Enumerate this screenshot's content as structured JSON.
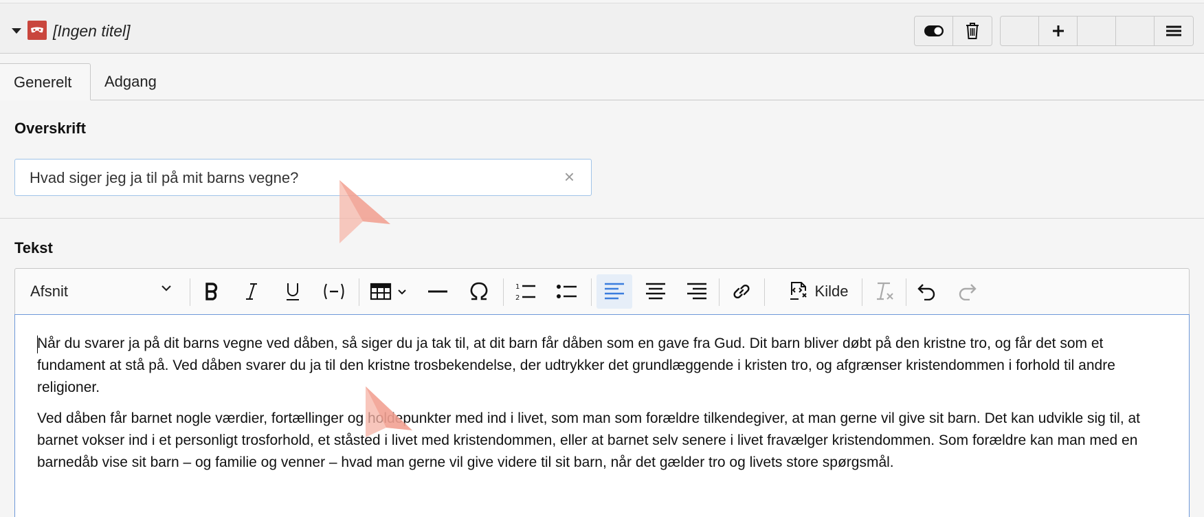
{
  "header": {
    "title": "[Ingen titel]",
    "buttons": {
      "toggle": "toggle-icon",
      "delete": "trash-icon",
      "add": "plus-icon",
      "menu": "hamburger-icon"
    }
  },
  "tabs": [
    {
      "label": "Generelt",
      "active": true
    },
    {
      "label": "Adgang",
      "active": false
    }
  ],
  "fields": {
    "overskrift": {
      "label": "Overskrift",
      "value": "Hvad siger jeg ja til på mit barns vegne?"
    },
    "tekst": {
      "label": "Tekst"
    }
  },
  "toolbar": {
    "format_select": "Afsnit",
    "source_label": "Kilde"
  },
  "content": {
    "paragraphs": [
      "Når du svarer ja på dit barns vegne ved dåben, så siger du ja tak til, at dit barn får dåben som en gave fra Gud. Dit barn bliver døbt på den kristne tro, og får det som et fundament at stå på. Ved dåben svarer du ja til den kristne trosbekendelse, der udtrykker det grundlæggende i kristen tro, og afgrænser kristendommen i forhold til andre religioner.",
      "Ved dåben får barnet nogle værdier, fortællinger og holdepunkter med ind i livet, som man som forældre tilkendegiver, at man gerne vil give sit barn. Det kan udvikle sig til, at barnet vokser ind i et personligt trosforhold, et ståsted i livet med kristendommen, eller at barnet selv senere i livet fravælger kristendommen. Som forældre kan man med en barnedåb vise sit barn – og familie og venner – hvad man gerne vil give videre til sit barn, når det gælder tro og livets store spørgsmål."
    ]
  },
  "colors": {
    "icon_red": "#c9463d",
    "active_align": "#3b7ddd",
    "pointer": "#f4a090"
  }
}
